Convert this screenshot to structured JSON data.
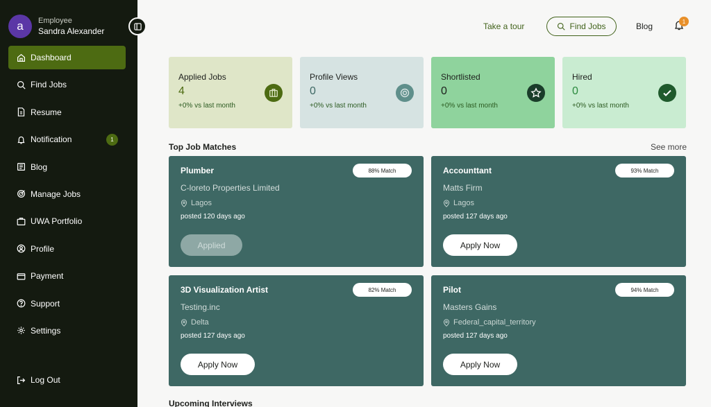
{
  "user": {
    "avatar_letter": "a",
    "role": "Employee",
    "name": "Sandra Alexander"
  },
  "nav": [
    {
      "label": "Dashboard",
      "icon": "home-icon",
      "active": true
    },
    {
      "label": "Find Jobs",
      "icon": "search-icon"
    },
    {
      "label": "Resume",
      "icon": "document-icon"
    },
    {
      "label": "Notification",
      "icon": "bell-icon",
      "badge": "1"
    },
    {
      "label": "Blog",
      "icon": "blog-icon"
    },
    {
      "label": "Manage Jobs",
      "icon": "target-icon"
    },
    {
      "label": "UWA Portfolio",
      "icon": "portfolio-icon"
    },
    {
      "label": "Profile",
      "icon": "user-icon"
    },
    {
      "label": "Payment",
      "icon": "wallet-icon"
    },
    {
      "label": "Support",
      "icon": "help-icon"
    },
    {
      "label": "Settings",
      "icon": "gear-icon"
    }
  ],
  "logout": {
    "label": "Log Out",
    "icon": "logout-icon"
  },
  "topbar": {
    "tour": "Take a tour",
    "find_jobs": "Find Jobs",
    "blog": "Blog",
    "notif_count": "1"
  },
  "stats": [
    {
      "title": "Applied Jobs",
      "value": "4",
      "change": "+0% vs last month",
      "icon": "briefcase-icon"
    },
    {
      "title": "Profile Views",
      "value": "0",
      "change": "+0% vs last month",
      "icon": "eye-icon"
    },
    {
      "title": "Shortlisted",
      "value": "0",
      "change": "+0% vs last month",
      "icon": "star-icon"
    },
    {
      "title": "Hired",
      "value": "0",
      "change": "+0% vs last month",
      "icon": "check-icon"
    }
  ],
  "colors": {
    "sidebar": "#141a10",
    "accent": "#4d6b12",
    "card": "#3e6864"
  },
  "sections": {
    "top_matches": "Top Job Matches",
    "see_more": "See more",
    "upcoming": "Upcoming Interviews"
  },
  "jobs": [
    {
      "title": "Plumber",
      "match": "88% Match",
      "company": "C-loreto Properties Limited",
      "location": "Lagos",
      "posted": "posted 120 days ago",
      "button": "Applied",
      "applied": true
    },
    {
      "title": "Accounttant",
      "match": "93% Match",
      "company": "Matts Firm",
      "location": "Lagos",
      "posted": "posted 127 days ago",
      "button": "Apply Now",
      "applied": false
    },
    {
      "title": "3D Visualization Artist",
      "match": "82% Match",
      "company": "Testing.inc",
      "location": "Delta",
      "posted": "posted 127 days ago",
      "button": "Apply Now",
      "applied": false
    },
    {
      "title": "Pilot",
      "match": "94% Match",
      "company": "Masters Gains",
      "location": "Federal_capital_territory",
      "posted": "posted 127 days ago",
      "button": "Apply Now",
      "applied": false
    }
  ]
}
